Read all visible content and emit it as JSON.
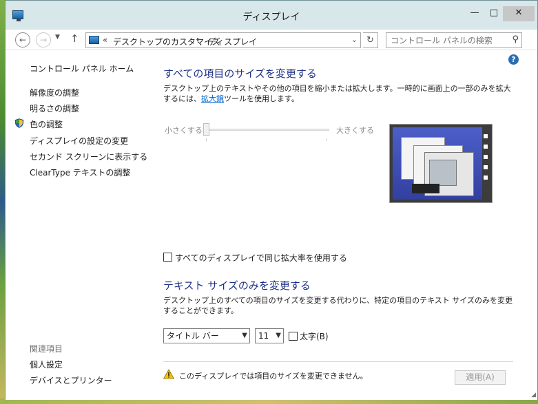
{
  "window": {
    "title": "ディスプレイ"
  },
  "titlebar": {
    "minimize": "—",
    "maximize": "□",
    "close": "✕"
  },
  "address": {
    "crumb1": "デスクトップのカスタマイズ",
    "crumb2": "ディスプレイ",
    "search_placeholder": "コントロール パネルの検索"
  },
  "sidebar": {
    "home": "コントロール パネル ホーム",
    "items": [
      "解像度の調整",
      "明るさの調整",
      "色の調整",
      "ディスプレイの設定の変更",
      "セカンド スクリーンに表示する",
      "ClearType テキストの調整"
    ],
    "related_heading": "関連項目",
    "related": [
      "個人設定",
      "デバイスとプリンター"
    ]
  },
  "main": {
    "heading1": "すべての項目のサイズを変更する",
    "desc1_before": "デスクトップ上のテキストやその他の項目を縮小または拡大します。一時的に画面上の一部のみを拡大するには、",
    "desc1_link": "拡大鏡",
    "desc1_after": "ツールを使用します。",
    "slider": {
      "min_label": "小さくする",
      "max_label": "大きくする",
      "value": 0
    },
    "same_scale_checkbox": "すべてのディスプレイで同じ拡大率を使用する",
    "same_scale_checked": false,
    "heading2": "テキスト サイズのみを変更する",
    "desc2": "デスクトップ上のすべての項目のサイズを変更する代わりに、特定の項目のテキスト サイズのみを変更することができます。",
    "item_select": "タイトル バー",
    "size_select": "11",
    "bold_label": "太字(B)",
    "bold_checked": false,
    "warning": "このディスプレイでは項目のサイズを変更できません。",
    "apply": "適用(A)"
  }
}
